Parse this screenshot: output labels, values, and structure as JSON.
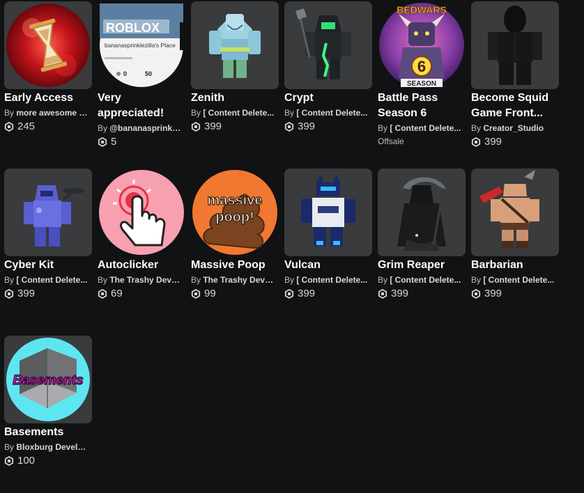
{
  "items": [
    {
      "name": "Early Access",
      "creator": "more awesome g...",
      "price": "245",
      "icon": "hourglass-icon"
    },
    {
      "name": "Very appreciated!",
      "creator": "@bananasprinkle...",
      "price": "5",
      "icon": "game-place-thumbnail",
      "thumb_text": {
        "logo": "ROBLOX",
        "place_name": "bananasprinklezilla's Place",
        "stat": "0",
        "stat2": "50"
      }
    },
    {
      "name": "Zenith",
      "creator": "[ Content Delete...",
      "price": "399",
      "icon": "zenith-avatar-icon"
    },
    {
      "name": "Crypt",
      "creator": "[ Content Delete...",
      "price": "399",
      "icon": "crypt-avatar-icon"
    },
    {
      "name": "Battle Pass Season 6",
      "creator": "[ Content Delete...",
      "status": "Offsale",
      "icon": "bedwars-season-icon",
      "thumb_text": {
        "logo": "BEDWARS",
        "number": "6",
        "season": "SEASON"
      }
    },
    {
      "name": "Become Squid Game Front...",
      "creator": "Creator_Studio",
      "price": "399",
      "icon": "squid-game-avatar-icon"
    },
    {
      "name": "Cyber Kit",
      "creator": "[ Content Delete...",
      "price": "399",
      "icon": "cyber-kit-avatar-icon"
    },
    {
      "name": "Autoclicker",
      "creator": "The Trashy Devel...",
      "price": "69",
      "icon": "tap-hand-icon"
    },
    {
      "name": "Massive Poop",
      "creator": "The Trashy Devel...",
      "price": "99",
      "icon": "poop-icon",
      "thumb_text": {
        "line1": "massive",
        "line2": "poop!"
      }
    },
    {
      "name": "Vulcan",
      "creator": "[ Content Delete...",
      "price": "399",
      "icon": "vulcan-avatar-icon"
    },
    {
      "name": "Grim Reaper",
      "creator": "[ Content Delete...",
      "price": "399",
      "icon": "reaper-avatar-icon"
    },
    {
      "name": "Barbarian",
      "creator": "[ Content Delete...",
      "price": "399",
      "icon": "barbarian-avatar-icon"
    },
    {
      "name": "Basements",
      "creator": "Bloxburg Develo...",
      "price": "100",
      "icon": "basement-room-icon",
      "thumb_text": {
        "label": "Basements"
      }
    }
  ],
  "labels": {
    "by": "By "
  },
  "colors": {
    "background": "#111214",
    "tile": "#393b3d",
    "text": "#ffffff",
    "muted": "#bdbebe"
  }
}
